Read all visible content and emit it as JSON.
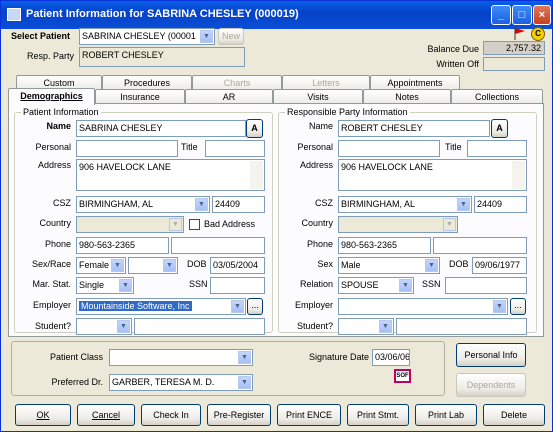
{
  "window": {
    "title": "Patient Information for SABRINA CHESLEY (000019)"
  },
  "header": {
    "select_patient_label": "Select Patient",
    "select_patient_value": "SABRINA CHESLEY (00001",
    "new_button": "New",
    "resp_party_label": "Resp. Party",
    "resp_party_value": "ROBERT CHESLEY",
    "balance_due_label": "Balance Due",
    "balance_due_value": "2,757.32",
    "written_off_label": "Written Off",
    "written_off_value": ""
  },
  "tabs_row1": [
    "Custom",
    "Procedures",
    "Charts",
    "Letters",
    "Appointments"
  ],
  "tabs_row2": [
    "Demographics",
    "Insurance",
    "AR",
    "Visits",
    "Notes",
    "Collections"
  ],
  "patient": {
    "group_title": "Patient Information",
    "name_label": "Name",
    "name_value": "SABRINA CHESLEY",
    "personal_label": "Personal",
    "title_label": "Title",
    "address_label": "Address",
    "address_value": "906 HAVELOCK LANE",
    "csz_label": "CSZ",
    "city_value": "BIRMINGHAM, AL",
    "zip_value": "24409",
    "country_label": "Country",
    "bad_address_label": "Bad Address",
    "phone_label": "Phone",
    "phone_value": "980-563-2365",
    "sexrace_label": "Sex/Race",
    "sex_value": "Female",
    "dob_label": "DOB",
    "dob_value": "03/05/2004",
    "marstat_label": "Mar. Stat.",
    "marstat_value": "Single",
    "ssn_label": "SSN",
    "employer_label": "Employer",
    "employer_value": "Mountainside Software, Inc",
    "student_label": "Student?"
  },
  "responsible": {
    "group_title": "Responsible Party Information",
    "name_label": "Name",
    "name_value": "ROBERT CHESLEY",
    "personal_label": "Personal",
    "title_label": "Title",
    "address_label": "Address",
    "address_value": "906 HAVELOCK LANE",
    "csz_label": "CSZ",
    "city_value": "BIRMINGHAM, AL",
    "zip_value": "24409",
    "country_label": "Country",
    "phone_label": "Phone",
    "phone_value": "980-563-2365",
    "sex_label": "Sex",
    "sex_value": "Male",
    "dob_label": "DOB",
    "dob_value": "09/06/1977",
    "relation_label": "Relation",
    "relation_value": "SPOUSE",
    "ssn_label": "SSN",
    "employer_label": "Employer",
    "student_label": "Student?"
  },
  "bottom": {
    "patient_class_label": "Patient Class",
    "preferred_dr_label": "Preferred Dr.",
    "preferred_dr_value": "GARBER, TERESA M. D.",
    "signature_date_label": "Signature Date",
    "signature_date_value": "03/06/06",
    "sig_icon_text": "SOF",
    "personal_info_button": "Personal Info",
    "dependents_button": "Dependents"
  },
  "buttons": {
    "ok": "OK",
    "cancel": "Cancel",
    "checkin": "Check In",
    "preregister": "Pre-Register",
    "print_ence": "Print ENCE",
    "print_stmt": "Print Stmt.",
    "print_lab": "Print Lab",
    "delete": "Delete"
  },
  "colors": {
    "titlebar": "#0542c8",
    "selection": "#316ac5",
    "window_bg": "#ece9d8"
  }
}
